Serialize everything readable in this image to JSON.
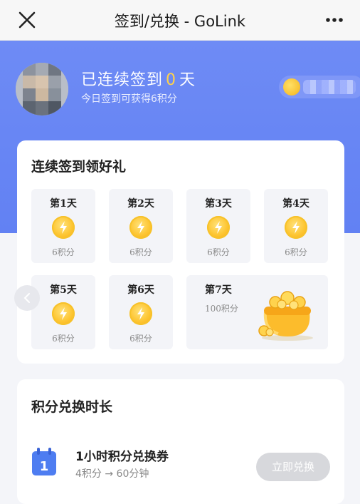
{
  "navbar": {
    "title": "签到/兑换 - GoLink",
    "close_icon": "close-icon",
    "more_icon": "more-dots-icon"
  },
  "hero": {
    "streak_prefix": "已连续签到",
    "streak_days": "0",
    "streak_suffix": "天",
    "subtitle": "今日签到可获得6积分",
    "colors": {
      "background": "#6a87f4",
      "streak_number": "#ffd24a"
    }
  },
  "checkin": {
    "title": "连续签到领好礼",
    "days": [
      {
        "label": "第1天",
        "points": "6积分"
      },
      {
        "label": "第2天",
        "points": "6积分"
      },
      {
        "label": "第3天",
        "points": "6积分"
      },
      {
        "label": "第4天",
        "points": "6积分"
      },
      {
        "label": "第5天",
        "points": "6积分"
      },
      {
        "label": "第6天",
        "points": "6积分"
      }
    ],
    "day7": {
      "label": "第7天",
      "points": "100积分"
    }
  },
  "exchange": {
    "title": "积分兑换时长",
    "item": {
      "title": "1小时积分兑换券",
      "detail": "4积分 → 60分钟",
      "button": "立即兑换",
      "calendar_day": "1"
    }
  }
}
